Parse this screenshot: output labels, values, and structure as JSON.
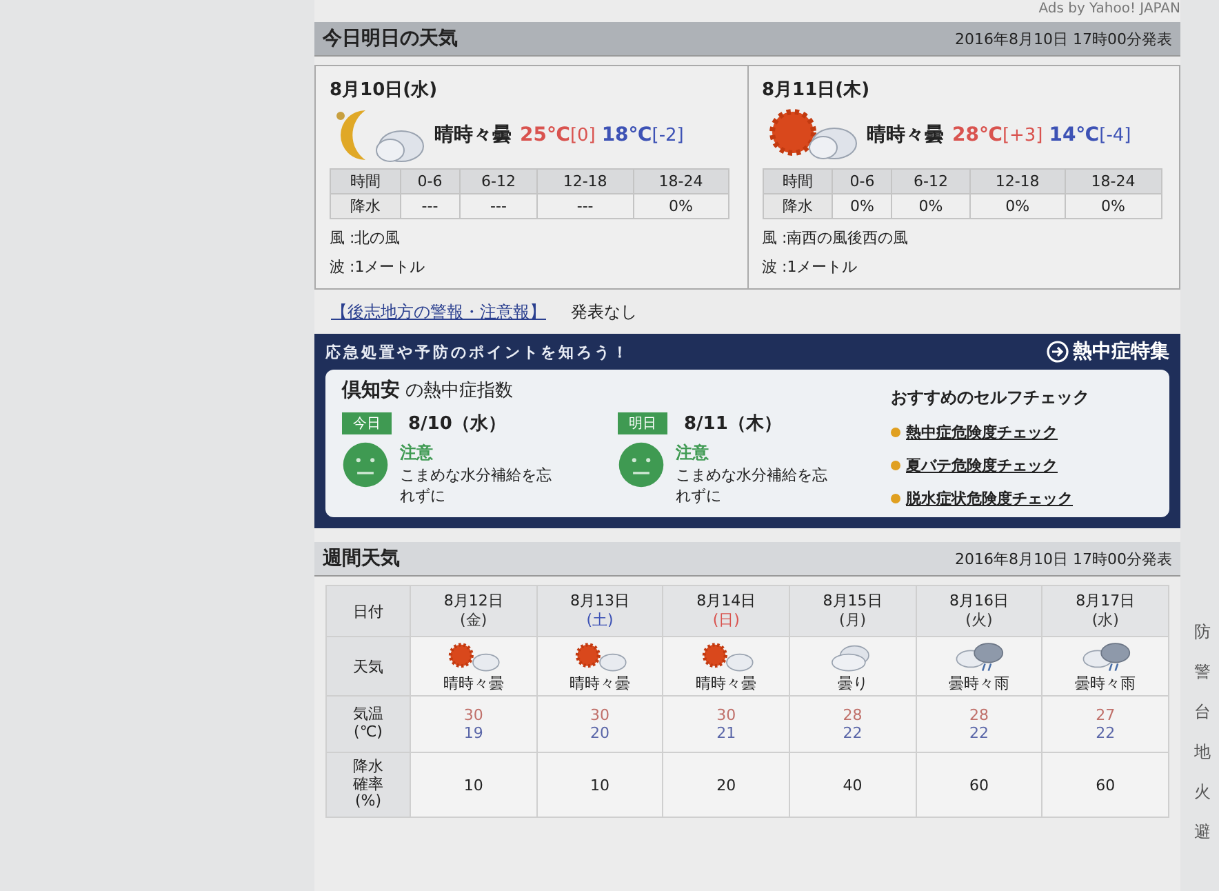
{
  "ads_label": "Ads by Yahoo! JAPAN",
  "today_tomorrow": {
    "title": "今日明日の天気",
    "issued": "2016年8月10日 17時00分発表",
    "days": [
      {
        "date": "8月10日(水)",
        "kind": "night_cloudy",
        "weather": "晴時々曇",
        "high": "25℃",
        "high_diff": "[0]",
        "low": "18℃",
        "low_diff": "[-2]",
        "time_label": "時間",
        "periods": [
          "0-6",
          "6-12",
          "12-18",
          "18-24"
        ],
        "rain_label": "降水",
        "rain": [
          "---",
          "---",
          "---",
          "0%"
        ],
        "wind": "風 :北の風",
        "wave": "波 :1メートル"
      },
      {
        "date": "8月11日(木)",
        "kind": "sunny_cloudy",
        "weather": "晴時々曇",
        "high": "28℃",
        "high_diff": "[+3]",
        "low": "14℃",
        "low_diff": "[-4]",
        "time_label": "時間",
        "periods": [
          "0-6",
          "6-12",
          "12-18",
          "18-24"
        ],
        "rain_label": "降水",
        "rain": [
          "0%",
          "0%",
          "0%",
          "0%"
        ],
        "wind": "風 :南西の風後西の風",
        "wave": "波 :1メートル"
      }
    ],
    "warning_link": "【後志地方の警報・注意報】",
    "warning_status": "発表なし"
  },
  "heat_banner": {
    "tagline": "応急処置や予防のポイントを知ろう！",
    "feature_link": "熱中症特集",
    "place": "倶知安",
    "index_title": "の熱中症指数",
    "days": [
      {
        "badge": "今日",
        "date": "8/10（水）",
        "level": "注意",
        "advice": "こまめな水分補給を忘れずに"
      },
      {
        "badge": "明日",
        "date": "8/11（木）",
        "level": "注意",
        "advice": "こまめな水分補給を忘れずに"
      }
    ],
    "self_check_title": "おすすめのセルフチェック",
    "self_checks": [
      "熱中症危険度チェック",
      "夏バテ危険度チェック",
      "脱水症状危険度チェック"
    ]
  },
  "weekly": {
    "title": "週間天気",
    "issued": "2016年8月10日 17時00分発表",
    "row_labels": [
      "日付",
      "天気",
      "気温(℃)",
      "降水確率(%)"
    ],
    "days": [
      {
        "date": "8月12日",
        "weekday": "(金)",
        "color": "#333333",
        "kind": "sunny_cloudy",
        "weather": "晴時々曇",
        "high": "30",
        "low": "19",
        "rain": "10"
      },
      {
        "date": "8月13日",
        "weekday": "(土)",
        "color": "#3d52b5",
        "kind": "sunny_cloudy",
        "weather": "晴時々曇",
        "high": "30",
        "low": "20",
        "rain": "10"
      },
      {
        "date": "8月14日",
        "weekday": "(日)",
        "color": "#d9534f",
        "kind": "sunny_cloudy",
        "weather": "晴時々曇",
        "high": "30",
        "low": "21",
        "rain": "20"
      },
      {
        "date": "8月15日",
        "weekday": "(月)",
        "color": "#333333",
        "kind": "cloudy",
        "weather": "曇り",
        "high": "28",
        "low": "22",
        "rain": "40"
      },
      {
        "date": "8月16日",
        "weekday": "(火)",
        "color": "#333333",
        "kind": "cloudy_rain",
        "weather": "曇時々雨",
        "high": "28",
        "low": "22",
        "rain": "60"
      },
      {
        "date": "8月17日",
        "weekday": "(水)",
        "color": "#333333",
        "kind": "cloudy_rain",
        "weather": "曇時々雨",
        "high": "27",
        "low": "22",
        "rain": "60"
      }
    ]
  },
  "sidebar_fragments": [
    "防",
    "警",
    "台",
    "地",
    "火",
    "避"
  ]
}
